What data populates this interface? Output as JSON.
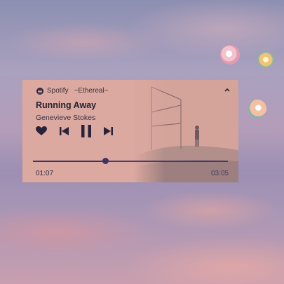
{
  "player": {
    "app_name": "Spotify",
    "playlist": "~Ethereal~",
    "title": "Running Away",
    "artist": "Genevieve Stokes",
    "elapsed": "01:07",
    "duration": "03:05",
    "progress": 0.37
  },
  "icons": {
    "app": "spotify-icon",
    "collapse": "chevron-up-icon",
    "like": "heart-icon",
    "previous": "skip-previous-icon",
    "play_pause": "pause-icon",
    "next": "skip-next-icon"
  },
  "colors": {
    "card": "#dca9a0",
    "accent": "#2d2a5a",
    "text": "#241f2f"
  }
}
